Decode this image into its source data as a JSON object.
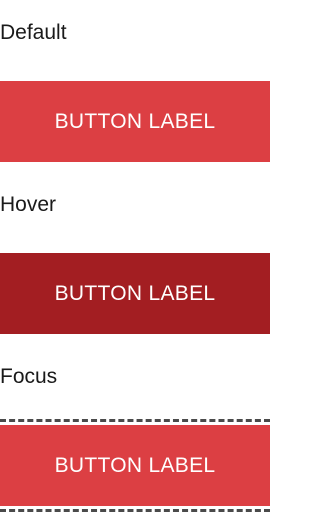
{
  "states": {
    "default": {
      "label": "Default",
      "button_label": "BUTTON LABEL",
      "button_color": "#dc3f43"
    },
    "hover": {
      "label": "Hover",
      "button_label": "BUTTON LABEL",
      "button_color": "#a31e22"
    },
    "focus": {
      "label": "Focus",
      "button_label": "BUTTON LABEL",
      "button_color": "#dc3f43",
      "focus_ring_color": "#4a4a4a"
    }
  }
}
